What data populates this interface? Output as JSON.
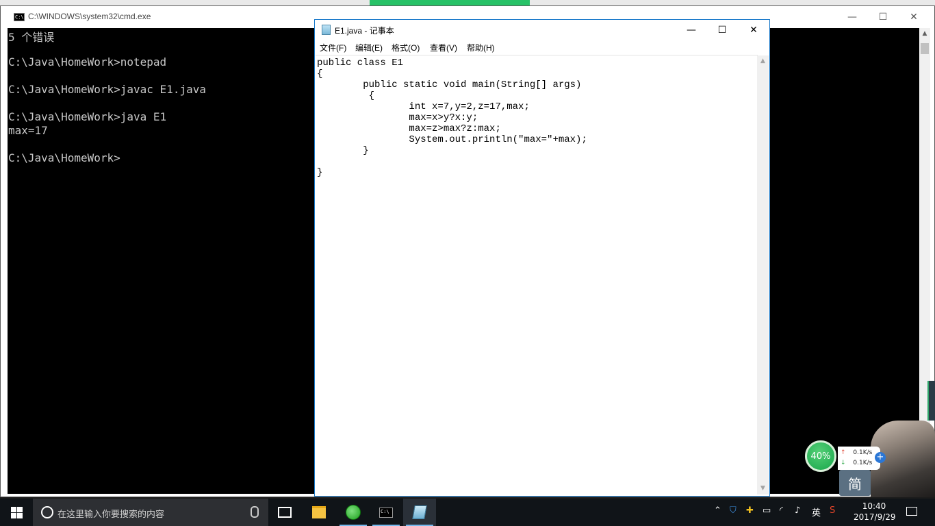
{
  "cmd": {
    "title": "C:\\WINDOWS\\system32\\cmd.exe",
    "lines": [
      "5 个错误",
      "",
      "C:\\Java\\HomeWork>notepad",
      "",
      "C:\\Java\\HomeWork>javac E1.java",
      "",
      "C:\\Java\\HomeWork>java E1",
      "max=17",
      "",
      "C:\\Java\\HomeWork>"
    ],
    "minimize": "—",
    "maximize": "☐",
    "close": "✕"
  },
  "notepad": {
    "title": "E1.java - 记事本",
    "menu": [
      "文件(F)",
      "编辑(E)",
      "格式(O)",
      "查看(V)",
      "帮助(H)"
    ],
    "minimize": "—",
    "maximize": "☐",
    "close": "✕",
    "code": [
      "public class E1",
      "{",
      "        public static void main(String[] args)",
      "         {",
      "                int x=7,y=2,z=17,max;",
      "                max=x>y?x:y;",
      "                max=z>max?z:max;",
      "                System.out.println(\"max=\"+max);",
      "        }",
      "",
      "}"
    ]
  },
  "taskbar": {
    "search_placeholder": "在这里输入你要搜索的内容",
    "tray": {
      "ime_lang": "英",
      "time": "10:40",
      "date": "2017/9/29"
    }
  },
  "widget": {
    "percent": "40%",
    "upload": "0.1K/s",
    "download": "0.1K/s",
    "ime": "简"
  },
  "colors": {
    "cmd_bg": "#000000",
    "cmd_text": "#c8c8c8",
    "notepad_border": "#1979ca",
    "taskbar": "#101418",
    "widget_green": "#17a64a"
  }
}
